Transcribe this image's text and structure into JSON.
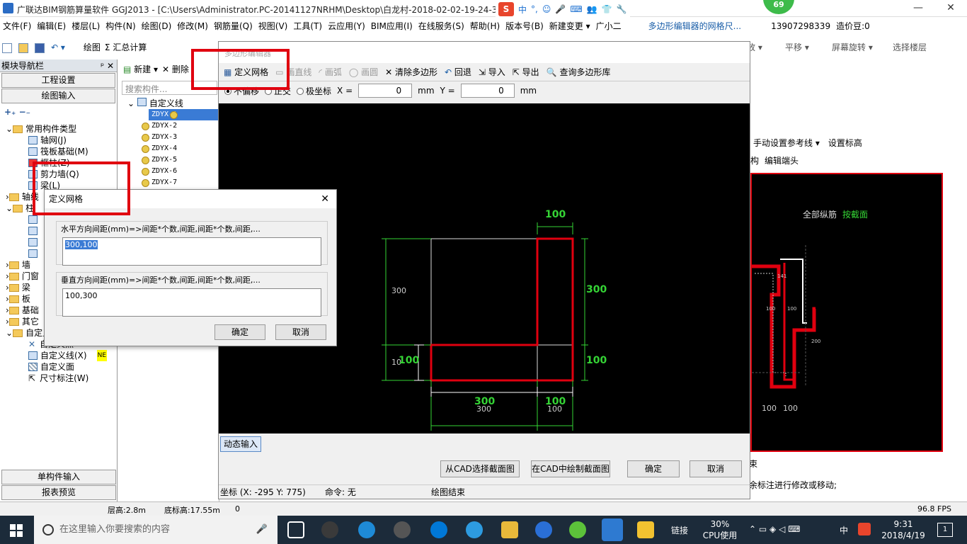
{
  "window": {
    "title": "广联达BIM钢筋算量软件 GGJ2013 - [C:\\Users\\Administrator.PC-20141127NRHM\\Desktop\\白龙村-2018-02-02-19-24-35",
    "min": "—",
    "max": "❐",
    "close": "✕"
  },
  "ime": {
    "logo": "S",
    "items": [
      "中",
      "°,",
      "☺",
      "🎤",
      "⌨",
      "👥",
      "👕",
      "🔧"
    ]
  },
  "notify_badge": "69",
  "menu": [
    "文件(F)",
    "编辑(E)",
    "楼层(L)",
    "构件(N)",
    "绘图(D)",
    "修改(M)",
    "钢筋量(Q)",
    "视图(V)",
    "工具(T)",
    "云应用(Y)",
    "BIM应用(I)",
    "在线服务(S)",
    "帮助(H)",
    "版本号(B)",
    "新建变更 ▾",
    "广小二"
  ],
  "menu_right": {
    "hint": "多边形编辑器的网格尺...",
    "phone": "13907298339",
    "price": "造价豆:0"
  },
  "toolbar": {
    "draw": "绘图",
    "sum": "Σ 汇总计算",
    "right_tools": [
      "缩放 ▾",
      "平移 ▾",
      "屏幕旋转 ▾",
      "选择楼层"
    ]
  },
  "leftnav": {
    "header": "模块导航栏",
    "header_pin": "ᵖ ✕",
    "btn_settings": "工程设置",
    "btn_draw": "绘图输入",
    "tree": [
      "常用构件类型",
      "轴网(J)",
      "筏板基础(M)",
      "框柱(Z)",
      "剪力墙(Q)",
      "梁(L)",
      "轴线",
      "柱",
      "",
      "",
      "",
      "",
      "墙",
      "门窗",
      "梁",
      "板",
      "基础",
      "其它",
      "自定义",
      "自定义点",
      "自定义线(X)",
      "自定义面",
      "尺寸标注(W)"
    ],
    "new_badge": "NE",
    "btn_single": "单构件输入",
    "btn_report": "报表预览"
  },
  "complist": {
    "btn_new": "新建 ▾",
    "btn_delete": "删除",
    "search_placeholder": "搜索构件...",
    "root": "自定义线",
    "items": [
      "ZDYX-1",
      "ZDYX-2",
      "ZDYX-3",
      "ZDYX-4",
      "ZDYX-5",
      "ZDYX-6",
      "ZDYX-7"
    ]
  },
  "editor": {
    "title": "多边形编辑器",
    "tools": [
      "定义网格",
      "画直线",
      "画弧",
      "画圆",
      "清除多边形",
      "回退",
      "导入",
      "导出",
      "查询多边形库"
    ],
    "opts": {
      "r1": "不偏移",
      "r2": "正交",
      "r3": "极坐标",
      "x_label": "X =",
      "x_val": "0",
      "y_label": "Y =",
      "y_val": "0",
      "unit": "mm"
    },
    "dims": {
      "top": "100",
      "right_top": "300",
      "right_bottom": "100",
      "left_top": "300",
      "left_bottom_a": "10",
      "left_bottom_b": "100",
      "bottom_left_green": "300",
      "bottom_left_white": "300",
      "bottom_right_green": "100",
      "bottom_right_white": "100"
    },
    "dyn_input": "动态输入",
    "btn_cad_select": "从CAD选择截面图",
    "btn_cad_draw": "在CAD中绘制截面图",
    "btn_ok": "确定",
    "btn_cancel": "取消",
    "status_coord": "坐标 (X: -295 Y: 775)",
    "status_cmd": "命令: 无",
    "status_msg": "绘图结束"
  },
  "rightpanel": {
    "tool1": "手动设置参考线 ▾",
    "tool2": "设置标高",
    "tool3": "构",
    "tool4": "编辑端头",
    "label_all": "全部纵筋",
    "label_section": "按截面",
    "dims": [
      "141",
      "100",
      "100",
      "200",
      "100",
      "100",
      "100",
      "100"
    ],
    "hint_bottom": "余标注进行修改或移动;",
    "hint_side": "束"
  },
  "griddlg": {
    "title": "定义网格",
    "close": "✕",
    "h_label": "水平方向间距(mm)=>间距*个数,间距,间距*个数,间距,...",
    "h_value": "300,100",
    "v_label": "垂直方向间距(mm)=>间距*个数,间距,间距*个数,间距,...",
    "v_value": "100,300",
    "ok": "确定",
    "cancel": "取消"
  },
  "statusbar": {
    "floor_h": "层高:2.8m",
    "base_h": "底标高:17.55m",
    "zero": "0",
    "fps": "96.8 FPS"
  },
  "taskbar": {
    "search_placeholder": "在这里输入你要搜索的内容",
    "link": "链接",
    "cpu_pct": "30%",
    "cpu_label": "CPU使用",
    "lang": "中",
    "time": "9:31",
    "date": "2018/4/19",
    "notif": "1"
  },
  "colors": {
    "highlight_red": "#e0000f",
    "dim_green": "#35d435",
    "canvas_bg": "#000000"
  }
}
